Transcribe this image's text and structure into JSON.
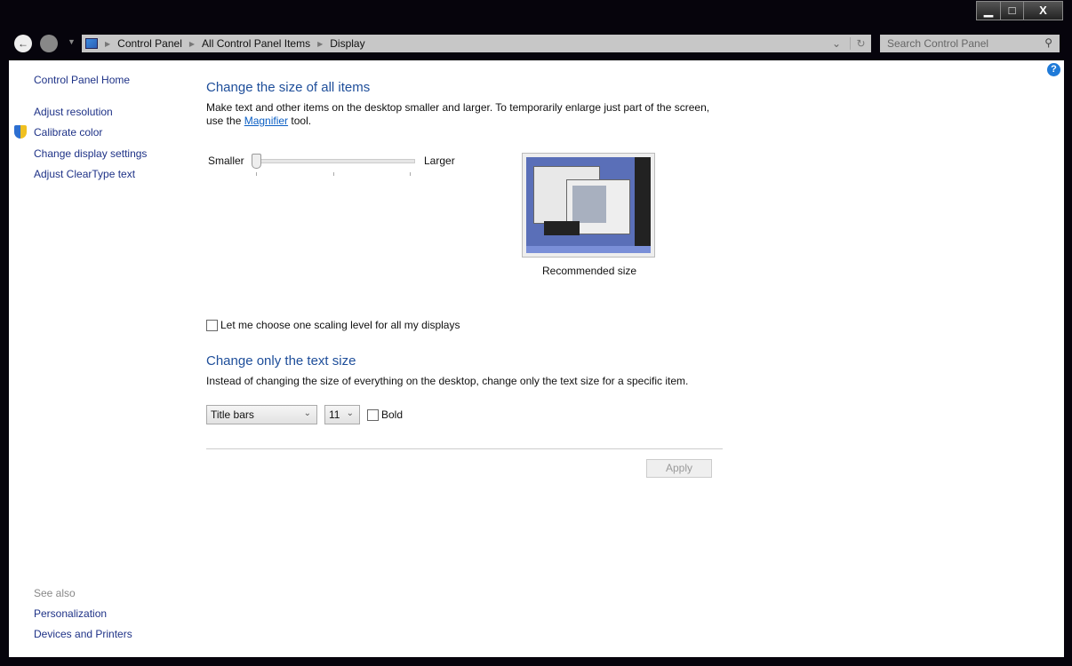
{
  "window": {
    "minimize": "▁",
    "maximize": "□",
    "close": "X"
  },
  "address": {
    "crumbs": [
      "Control Panel",
      "All Control Panel Items",
      "Display"
    ]
  },
  "search": {
    "placeholder": "Search Control Panel"
  },
  "sidebar": {
    "home": "Control Panel Home",
    "items": [
      "Adjust resolution",
      "Calibrate color",
      "Change display settings",
      "Adjust ClearType text"
    ],
    "see_also": "See also",
    "see_also_items": [
      "Personalization",
      "Devices and Printers"
    ]
  },
  "main": {
    "section1_title": "Change the size of all items",
    "desc_part1": "Make text and other items on the desktop smaller and larger. To temporarily enlarge just part of the screen, use the ",
    "magnifier_link": "Magnifier",
    "desc_part2": " tool.",
    "slider": {
      "min_label": "Smaller",
      "max_label": "Larger",
      "value_fraction": 0
    },
    "preview_caption": "Recommended size",
    "scaling_checkbox": {
      "label": "Let me choose one scaling level for all my displays",
      "checked": false
    },
    "section2_title": "Change only the text size",
    "section2_desc": "Instead of changing the size of everything on the desktop, change only the text size for a specific item.",
    "item_select": "Title bars",
    "size_select": "11",
    "bold_label": "Bold",
    "apply": "Apply"
  }
}
